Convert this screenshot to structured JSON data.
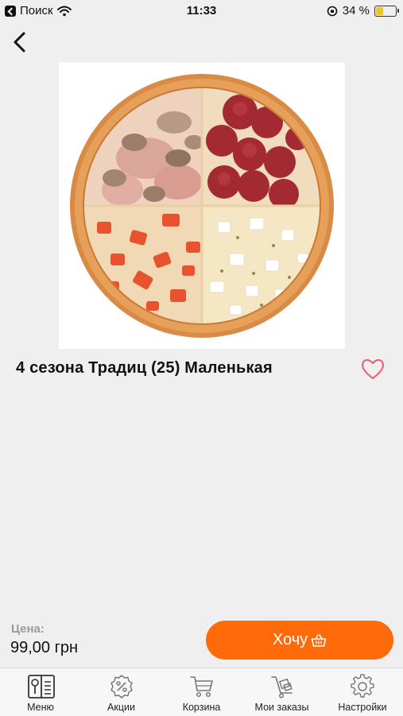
{
  "status_bar": {
    "back_app": "Поиск",
    "time": "11:33",
    "battery_percent": "34 %",
    "battery_level": 0.34
  },
  "product": {
    "title": "4 сезона Традиц (25) Маленькая",
    "favorite": false
  },
  "purchase": {
    "price_label": "Цена:",
    "price_value": "99,00 грн",
    "buy_label": "Хочу"
  },
  "tabbar": {
    "items": [
      {
        "label": "Меню",
        "icon": "menu-book-icon"
      },
      {
        "label": "Акции",
        "icon": "discount-badge-icon"
      },
      {
        "label": "Корзина",
        "icon": "cart-icon"
      },
      {
        "label": "Мои заказы",
        "icon": "orders-trolley-icon"
      },
      {
        "label": "Настройки",
        "icon": "gear-icon"
      }
    ]
  },
  "colors": {
    "accent": "#ff6a0a",
    "favorite": "#e8637c",
    "background": "#efeff0"
  }
}
